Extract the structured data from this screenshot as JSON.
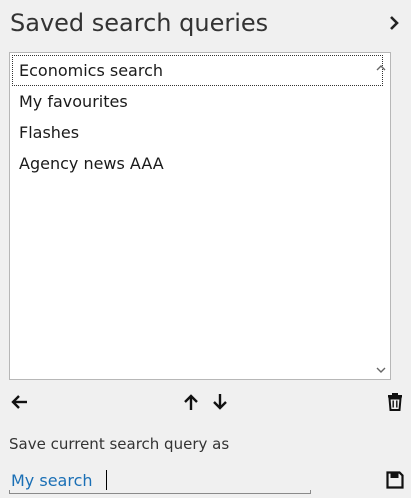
{
  "header": {
    "title": "Saved search queries",
    "expand_icon": "chevron-right-icon"
  },
  "saved_queries": {
    "items": [
      {
        "label": "Economics search",
        "selected": true
      },
      {
        "label": "My favourites",
        "selected": false
      },
      {
        "label": "Flashes",
        "selected": false
      },
      {
        "label": "Agency news AAA",
        "selected": false
      }
    ],
    "scroll_up_icon": "chevron-up-icon",
    "scroll_down_icon": "chevron-down-icon"
  },
  "toolbar": {
    "back_icon": "arrow-left-icon",
    "move_up_icon": "arrow-up-icon",
    "move_down_icon": "arrow-down-icon",
    "delete_icon": "trash-icon"
  },
  "save_form": {
    "label": "Save current search query as",
    "input_value": "My search",
    "save_icon": "save-icon"
  },
  "colors": {
    "background": "#f0f0f0",
    "list_background": "#ffffff",
    "input_text": "#1a6fb5"
  }
}
